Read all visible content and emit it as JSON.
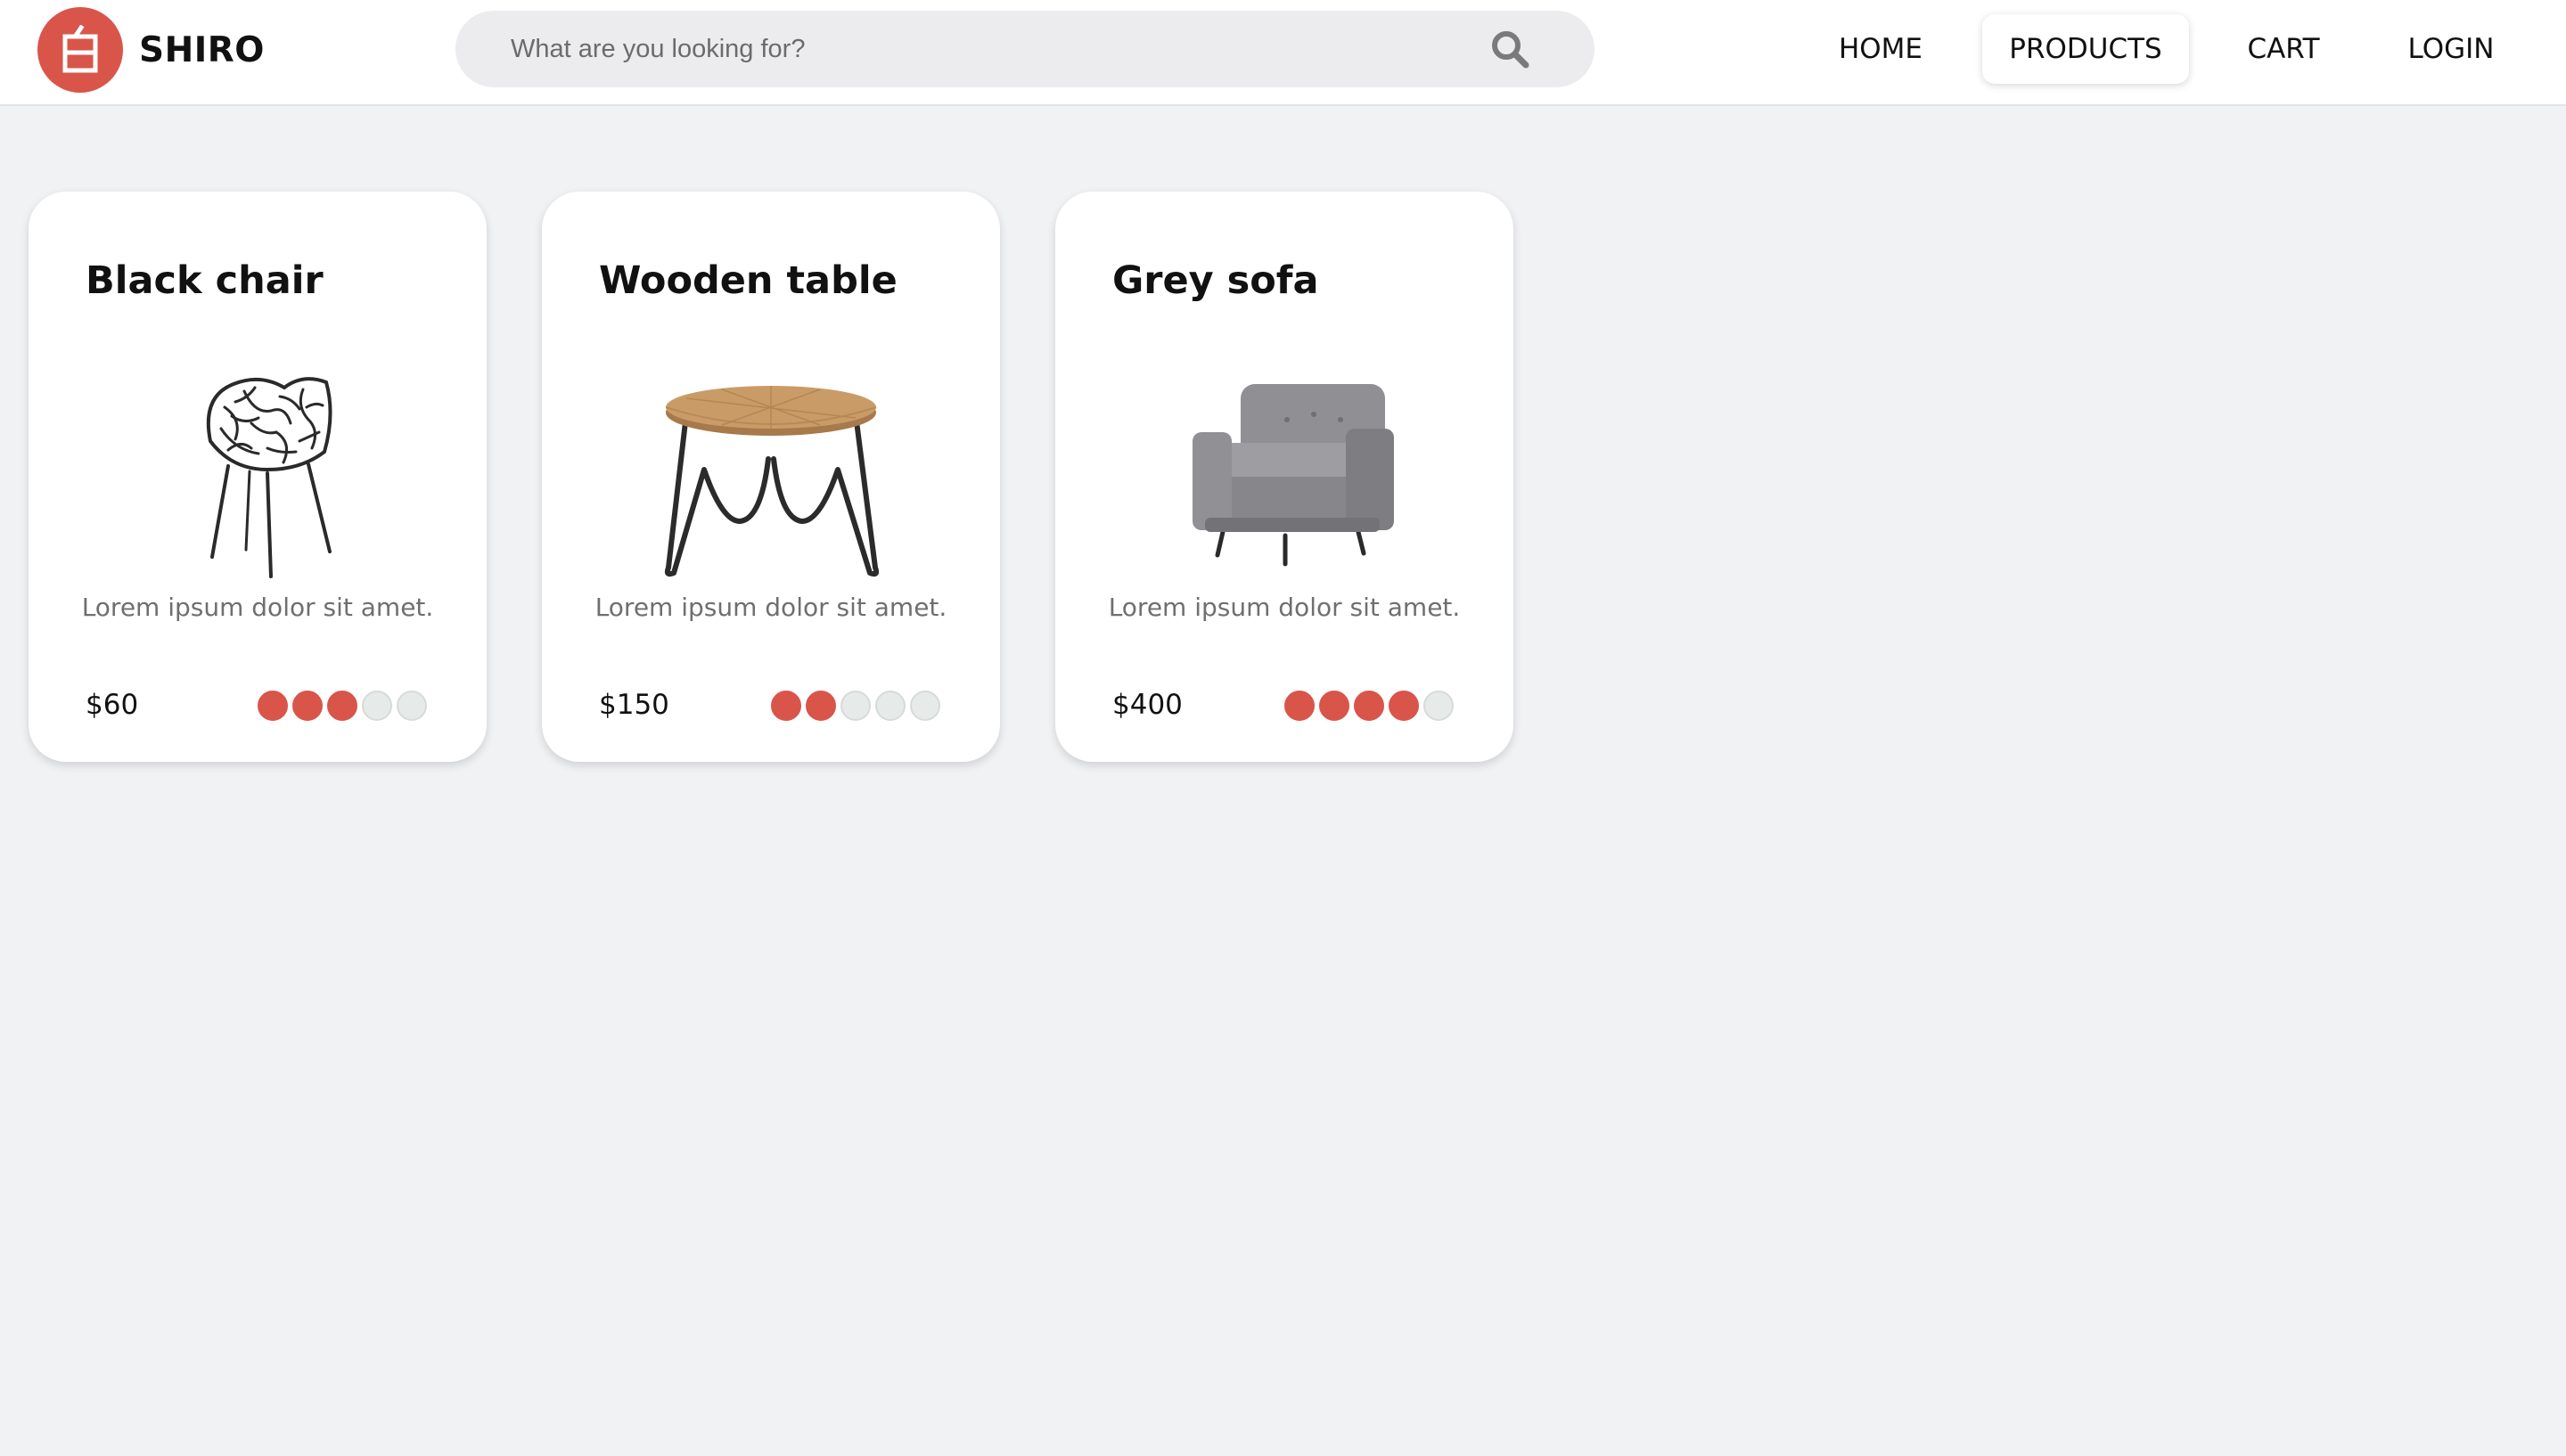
{
  "brand": {
    "name": "SHIRO",
    "logo_glyph": "白",
    "accent": "#d9554a"
  },
  "search": {
    "placeholder": "What are you looking for?",
    "icon": "search-icon"
  },
  "nav": {
    "items": [
      {
        "label": "HOME",
        "active": false
      },
      {
        "label": "PRODUCTS",
        "active": true
      },
      {
        "label": "CART",
        "active": false
      },
      {
        "label": "LOGIN",
        "active": false
      }
    ]
  },
  "products": [
    {
      "title": "Black chair",
      "description": "Lorem ipsum dolor sit amet.",
      "price": "$60",
      "rating": 3,
      "rating_max": 5,
      "image": "black-chair-image"
    },
    {
      "title": "Wooden table",
      "description": "Lorem ipsum dolor sit amet.",
      "price": "$150",
      "rating": 2,
      "rating_max": 5,
      "image": "wooden-table-image"
    },
    {
      "title": "Grey sofa",
      "description": "Lorem ipsum dolor sit amet.",
      "price": "$400",
      "rating": 4,
      "rating_max": 5,
      "image": "grey-sofa-image"
    }
  ]
}
